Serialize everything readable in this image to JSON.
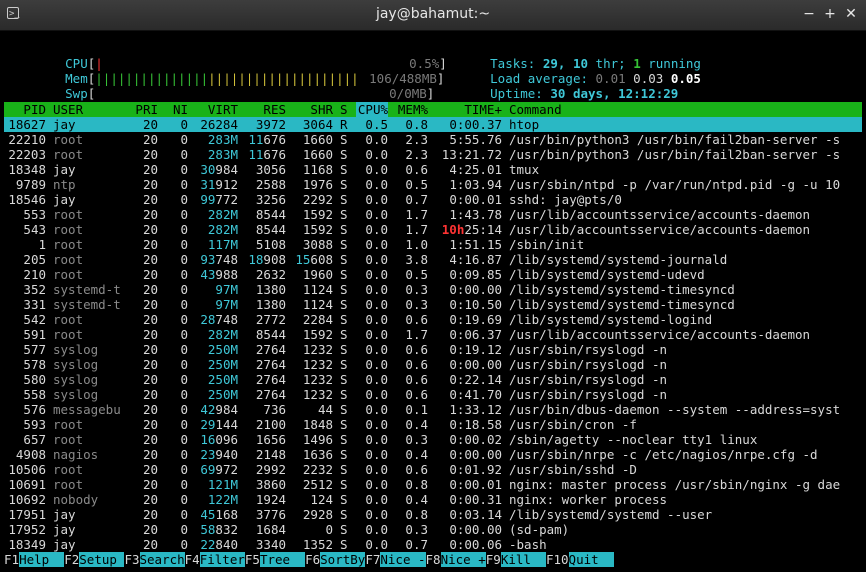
{
  "window": {
    "title": "jay@bahamut:~"
  },
  "meters": {
    "cpu": {
      "label": "CPU",
      "value": "0.5%"
    },
    "mem": {
      "label": "Mem",
      "value": "106/488MB",
      "fraction": 0.217
    },
    "swp": {
      "label": "Swp",
      "value": "0/0MB"
    }
  },
  "stats": {
    "tasks_label": "Tasks:",
    "tasks": "29,",
    "threads": "10",
    "thr_label": "thr;",
    "running": "1",
    "running_label": "running",
    "load_label": "Load average:",
    "load1": "0.01",
    "load5": "0.03",
    "load15": "0.05",
    "uptime_label": "Uptime:",
    "uptime": "30 days, 12:12:29"
  },
  "columns": [
    "PID",
    "USER",
    "PRI",
    "NI",
    "VIRT",
    "RES",
    "SHR",
    "S",
    "CPU%",
    "MEM%",
    "TIME+",
    "Command"
  ],
  "processes": [
    {
      "pid": "18627",
      "user": "jay",
      "pri": "20",
      "ni": "0",
      "virt": "26284",
      "res": "3972",
      "shr": "3064",
      "s": "R",
      "cpu": "0.5",
      "mem": "0.8",
      "time": "0:00.37",
      "cmd": "htop"
    },
    {
      "pid": "22210",
      "user": "root",
      "pri": "20",
      "ni": "0",
      "virt": "283M",
      "res": "11676",
      "shr": "1660",
      "s": "S",
      "cpu": "0.0",
      "mem": "2.3",
      "time": "5:55.76",
      "cmd": "/usr/bin/python3 /usr/bin/fail2ban-server -s"
    },
    {
      "pid": "22203",
      "user": "root",
      "pri": "20",
      "ni": "0",
      "virt": "283M",
      "res": "11676",
      "shr": "1660",
      "s": "S",
      "cpu": "0.0",
      "mem": "2.3",
      "time": "13:21.72",
      "cmd": "/usr/bin/python3 /usr/bin/fail2ban-server -s"
    },
    {
      "pid": "18348",
      "user": "jay",
      "pri": "20",
      "ni": "0",
      "virt": "30984",
      "res": "3056",
      "shr": "1168",
      "s": "S",
      "cpu": "0.0",
      "mem": "0.6",
      "time": "4:25.01",
      "cmd": "tmux"
    },
    {
      "pid": "9789",
      "user": "ntp",
      "pri": "20",
      "ni": "0",
      "virt": "31912",
      "res": "2588",
      "shr": "1976",
      "s": "S",
      "cpu": "0.0",
      "mem": "0.5",
      "time": "1:03.94",
      "cmd": "/usr/sbin/ntpd -p /var/run/ntpd.pid -g -u 10"
    },
    {
      "pid": "18546",
      "user": "jay",
      "pri": "20",
      "ni": "0",
      "virt": "99772",
      "res": "3256",
      "shr": "2292",
      "s": "S",
      "cpu": "0.0",
      "mem": "0.7",
      "time": "0:00.01",
      "cmd": "sshd: jay@pts/0"
    },
    {
      "pid": "553",
      "user": "root",
      "pri": "20",
      "ni": "0",
      "virt": "282M",
      "res": "8544",
      "shr": "1592",
      "s": "S",
      "cpu": "0.0",
      "mem": "1.7",
      "time": "1:43.78",
      "cmd": "/usr/lib/accountsservice/accounts-daemon"
    },
    {
      "pid": "543",
      "user": "root",
      "pri": "20",
      "ni": "0",
      "virt": "282M",
      "res": "8544",
      "shr": "1592",
      "s": "S",
      "cpu": "0.0",
      "mem": "1.7",
      "time": "10h25:14",
      "cmd": "/usr/lib/accountsservice/accounts-daemon"
    },
    {
      "pid": "1",
      "user": "root",
      "pri": "20",
      "ni": "0",
      "virt": "117M",
      "res": "5108",
      "shr": "3088",
      "s": "S",
      "cpu": "0.0",
      "mem": "1.0",
      "time": "1:51.15",
      "cmd": "/sbin/init"
    },
    {
      "pid": "205",
      "user": "root",
      "pri": "20",
      "ni": "0",
      "virt": "93748",
      "res": "18908",
      "shr": "15608",
      "s": "S",
      "cpu": "0.0",
      "mem": "3.8",
      "time": "4:16.87",
      "cmd": "/lib/systemd/systemd-journald"
    },
    {
      "pid": "210",
      "user": "root",
      "pri": "20",
      "ni": "0",
      "virt": "43988",
      "res": "2632",
      "shr": "1960",
      "s": "S",
      "cpu": "0.0",
      "mem": "0.5",
      "time": "0:09.85",
      "cmd": "/lib/systemd/systemd-udevd"
    },
    {
      "pid": "352",
      "user": "systemd-t",
      "pri": "20",
      "ni": "0",
      "virt": "97M",
      "res": "1380",
      "shr": "1124",
      "s": "S",
      "cpu": "0.0",
      "mem": "0.3",
      "time": "0:00.00",
      "cmd": "/lib/systemd/systemd-timesyncd"
    },
    {
      "pid": "331",
      "user": "systemd-t",
      "pri": "20",
      "ni": "0",
      "virt": "97M",
      "res": "1380",
      "shr": "1124",
      "s": "S",
      "cpu": "0.0",
      "mem": "0.3",
      "time": "0:10.50",
      "cmd": "/lib/systemd/systemd-timesyncd"
    },
    {
      "pid": "542",
      "user": "root",
      "pri": "20",
      "ni": "0",
      "virt": "28748",
      "res": "2772",
      "shr": "2284",
      "s": "S",
      "cpu": "0.0",
      "mem": "0.6",
      "time": "0:19.69",
      "cmd": "/lib/systemd/systemd-logind"
    },
    {
      "pid": "591",
      "user": "root",
      "pri": "20",
      "ni": "0",
      "virt": "282M",
      "res": "8544",
      "shr": "1592",
      "s": "S",
      "cpu": "0.0",
      "mem": "1.7",
      "time": "0:06.37",
      "cmd": "/usr/lib/accountsservice/accounts-daemon"
    },
    {
      "pid": "577",
      "user": "syslog",
      "pri": "20",
      "ni": "0",
      "virt": "250M",
      "res": "2764",
      "shr": "1232",
      "s": "S",
      "cpu": "0.0",
      "mem": "0.6",
      "time": "0:19.12",
      "cmd": "/usr/sbin/rsyslogd -n"
    },
    {
      "pid": "578",
      "user": "syslog",
      "pri": "20",
      "ni": "0",
      "virt": "250M",
      "res": "2764",
      "shr": "1232",
      "s": "S",
      "cpu": "0.0",
      "mem": "0.6",
      "time": "0:00.00",
      "cmd": "/usr/sbin/rsyslogd -n"
    },
    {
      "pid": "580",
      "user": "syslog",
      "pri": "20",
      "ni": "0",
      "virt": "250M",
      "res": "2764",
      "shr": "1232",
      "s": "S",
      "cpu": "0.0",
      "mem": "0.6",
      "time": "0:22.14",
      "cmd": "/usr/sbin/rsyslogd -n"
    },
    {
      "pid": "558",
      "user": "syslog",
      "pri": "20",
      "ni": "0",
      "virt": "250M",
      "res": "2764",
      "shr": "1232",
      "s": "S",
      "cpu": "0.0",
      "mem": "0.6",
      "time": "0:41.70",
      "cmd": "/usr/sbin/rsyslogd -n"
    },
    {
      "pid": "576",
      "user": "messagebu",
      "pri": "20",
      "ni": "0",
      "virt": "42984",
      "res": "736",
      "shr": "44",
      "s": "S",
      "cpu": "0.0",
      "mem": "0.1",
      "time": "1:33.12",
      "cmd": "/usr/bin/dbus-daemon --system --address=syst"
    },
    {
      "pid": "593",
      "user": "root",
      "pri": "20",
      "ni": "0",
      "virt": "29144",
      "res": "2100",
      "shr": "1848",
      "s": "S",
      "cpu": "0.0",
      "mem": "0.4",
      "time": "0:18.58",
      "cmd": "/usr/sbin/cron -f"
    },
    {
      "pid": "657",
      "user": "root",
      "pri": "20",
      "ni": "0",
      "virt": "16096",
      "res": "1656",
      "shr": "1496",
      "s": "S",
      "cpu": "0.0",
      "mem": "0.3",
      "time": "0:00.02",
      "cmd": "/sbin/agetty --noclear tty1 linux"
    },
    {
      "pid": "4908",
      "user": "nagios",
      "pri": "20",
      "ni": "0",
      "virt": "23940",
      "res": "2148",
      "shr": "1636",
      "s": "S",
      "cpu": "0.0",
      "mem": "0.4",
      "time": "0:00.00",
      "cmd": "/usr/sbin/nrpe -c /etc/nagios/nrpe.cfg -d"
    },
    {
      "pid": "10506",
      "user": "root",
      "pri": "20",
      "ni": "0",
      "virt": "69972",
      "res": "2992",
      "shr": "2232",
      "s": "S",
      "cpu": "0.0",
      "mem": "0.6",
      "time": "0:01.92",
      "cmd": "/usr/sbin/sshd -D"
    },
    {
      "pid": "10691",
      "user": "root",
      "pri": "20",
      "ni": "0",
      "virt": "121M",
      "res": "3860",
      "shr": "2512",
      "s": "S",
      "cpu": "0.0",
      "mem": "0.8",
      "time": "0:00.01",
      "cmd": "nginx: master process /usr/sbin/nginx -g dae"
    },
    {
      "pid": "10692",
      "user": "nobody",
      "pri": "20",
      "ni": "0",
      "virt": "122M",
      "res": "1924",
      "shr": "124",
      "s": "S",
      "cpu": "0.0",
      "mem": "0.4",
      "time": "0:00.31",
      "cmd": "nginx: worker process"
    },
    {
      "pid": "17951",
      "user": "jay",
      "pri": "20",
      "ni": "0",
      "virt": "45168",
      "res": "3776",
      "shr": "2928",
      "s": "S",
      "cpu": "0.0",
      "mem": "0.8",
      "time": "0:03.14",
      "cmd": "/lib/systemd/systemd --user"
    },
    {
      "pid": "17952",
      "user": "jay",
      "pri": "20",
      "ni": "0",
      "virt": "58832",
      "res": "1684",
      "shr": "0",
      "s": "S",
      "cpu": "0.0",
      "mem": "0.3",
      "time": "0:00.00",
      "cmd": "(sd-pam)"
    },
    {
      "pid": "18349",
      "user": "jay",
      "pri": "20",
      "ni": "0",
      "virt": "22840",
      "res": "3340",
      "shr": "1352",
      "s": "S",
      "cpu": "0.0",
      "mem": "0.7",
      "time": "0:00.06",
      "cmd": "-bash"
    }
  ],
  "footer": [
    {
      "key": "F1",
      "label": "Help"
    },
    {
      "key": "F2",
      "label": "Setup"
    },
    {
      "key": "F3",
      "label": "Search"
    },
    {
      "key": "F4",
      "label": "Filter"
    },
    {
      "key": "F5",
      "label": "Tree"
    },
    {
      "key": "F6",
      "label": "SortBy"
    },
    {
      "key": "F7",
      "label": "Nice -"
    },
    {
      "key": "F8",
      "label": "Nice +"
    },
    {
      "key": "F9",
      "label": "Kill"
    },
    {
      "key": "F10",
      "label": "Quit"
    }
  ],
  "colors": {
    "selected": "#2ab8c4",
    "header": "#19b219",
    "cyan": "#3fc8d8",
    "green": "#36c236"
  }
}
